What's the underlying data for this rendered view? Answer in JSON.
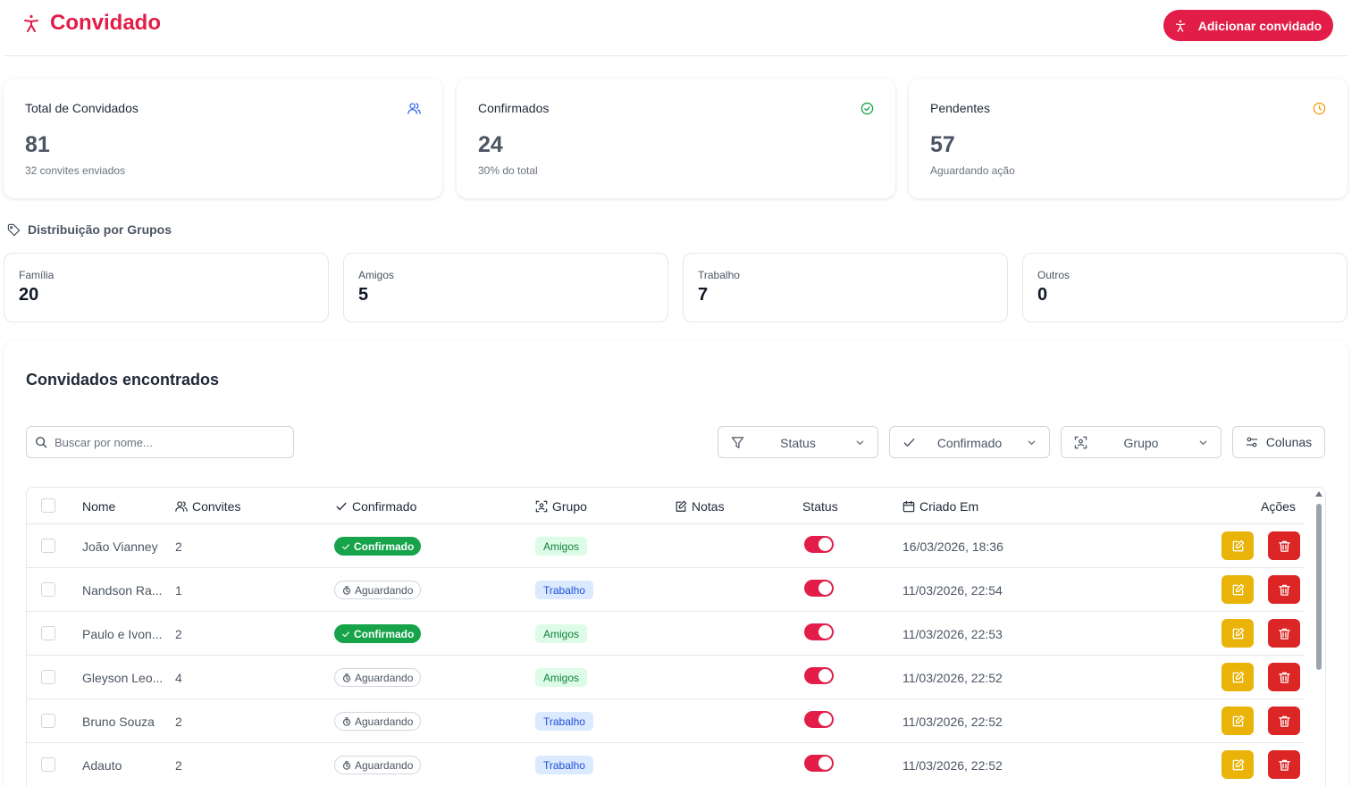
{
  "header": {
    "title": "Convidado",
    "add_button": "Adicionar convidado"
  },
  "stats": [
    {
      "label": "Total de Convidados",
      "value": "81",
      "sub": "32 convites enviados",
      "icon": "users-icon",
      "color": "#2563eb"
    },
    {
      "label": "Confirmados",
      "value": "24",
      "sub": "30% do total",
      "icon": "check-circle-icon",
      "color": "#16a34a"
    },
    {
      "label": "Pendentes",
      "value": "57",
      "sub": "Aguardando ação",
      "icon": "clock-icon",
      "color": "#f59e0b"
    }
  ],
  "distribution": {
    "title": "Distribuição por Grupos",
    "groups": [
      {
        "label": "Família",
        "value": "20"
      },
      {
        "label": "Amigos",
        "value": "5"
      },
      {
        "label": "Trabalho",
        "value": "7"
      },
      {
        "label": "Outros",
        "value": "0"
      }
    ]
  },
  "panel": {
    "title": "Convidados encontrados",
    "search_placeholder": "Buscar por nome...",
    "filters": {
      "status": "Status",
      "confirmado": "Confirmado",
      "grupo": "Grupo"
    },
    "columns_button": "Colunas"
  },
  "table": {
    "headers": {
      "nome": "Nome",
      "convites": "Convites",
      "confirmado": "Confirmado",
      "grupo": "Grupo",
      "notas": "Notas",
      "status": "Status",
      "criado": "Criado Em",
      "acoes": "Ações"
    },
    "rows": [
      {
        "nome": "João Vianney",
        "convites": "2",
        "confirmado": "Confirmado",
        "grupo": "Amigos",
        "criado": "16/03/2026, 18:36"
      },
      {
        "nome": "Nandson Ra...",
        "convites": "1",
        "confirmado": "Aguardando",
        "grupo": "Trabalho",
        "criado": "11/03/2026, 22:54"
      },
      {
        "nome": "Paulo e Ivon...",
        "convites": "2",
        "confirmado": "Confirmado",
        "grupo": "Amigos",
        "criado": "11/03/2026, 22:53"
      },
      {
        "nome": "Gleyson Leo...",
        "convites": "4",
        "confirmado": "Aguardando",
        "grupo": "Amigos",
        "criado": "11/03/2026, 22:52"
      },
      {
        "nome": "Bruno Souza",
        "convites": "2",
        "confirmado": "Aguardando",
        "grupo": "Trabalho",
        "criado": "11/03/2026, 22:52"
      },
      {
        "nome": "Adauto",
        "convites": "2",
        "confirmado": "Aguardando",
        "grupo": "Trabalho",
        "criado": "11/03/2026, 22:52"
      }
    ]
  },
  "colors": {
    "brand": "#e11d48",
    "confirmed": "#16a34a",
    "edit": "#eab308",
    "delete": "#dc2626"
  }
}
